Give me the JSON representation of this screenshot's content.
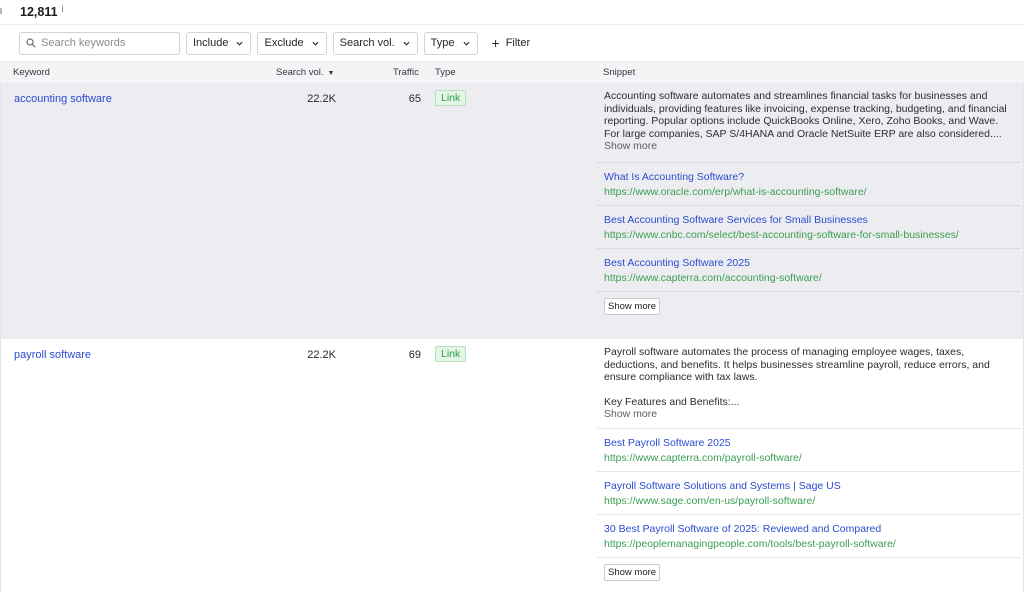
{
  "header": {
    "count": "12,811",
    "info_icon": "i"
  },
  "filters": {
    "search_placeholder": "Search keywords",
    "include": "Include",
    "exclude": "Exclude",
    "search_vol": "Search vol.",
    "type": "Type",
    "add_filter": "Filter"
  },
  "columns": {
    "keyword": "Keyword",
    "search_vol": "Search vol.",
    "traffic": "Traffic",
    "type": "Type",
    "snippet": "Snippet"
  },
  "rows": [
    {
      "keyword": "accounting software",
      "search_vol": "22.2K",
      "traffic": "65",
      "type": "Link",
      "snippet_text": "Accounting software automates and streamlines financial tasks for businesses and individuals, providing features like invoicing, expense tracking, budgeting, and financial reporting. Popular options include QuickBooks Online, Xero, Zoho Books, and Wave. For large companies, SAP S/4HANA and Oracle NetSuite ERP are also considered....",
      "snippet_more": "Show more",
      "links": [
        {
          "title": "What Is Accounting Software?",
          "url": "https://www.oracle.com/erp/what-is-accounting-software/"
        },
        {
          "title": "Best Accounting Software Services for Small Businesses",
          "url": "https://www.cnbc.com/select/best-accounting-software-for-small-businesses/"
        },
        {
          "title": "Best Accounting Software 2025",
          "url": "https://www.capterra.com/accounting-software/"
        }
      ],
      "show_more_button": "Show more"
    },
    {
      "keyword": "payroll software",
      "search_vol": "22.2K",
      "traffic": "69",
      "type": "Link",
      "snippet_text": "Payroll software automates the process of managing employee wages, taxes, deductions, and benefits. It helps businesses streamline payroll, reduce errors, and ensure compliance with tax laws.",
      "snippet_text_2": "Key Features and Benefits:...",
      "snippet_more": "Show more",
      "links": [
        {
          "title": "Best Payroll Software 2025",
          "url": "https://www.capterra.com/payroll-software/"
        },
        {
          "title": "Payroll Software Solutions and Systems | Sage US",
          "url": "https://www.sage.com/en-us/payroll-software/"
        },
        {
          "title": "30 Best Payroll Software of 2025: Reviewed and Compared",
          "url": "https://peoplemanagingpeople.com/tools/best-payroll-software/"
        }
      ],
      "show_more_button": "Show more"
    }
  ]
}
